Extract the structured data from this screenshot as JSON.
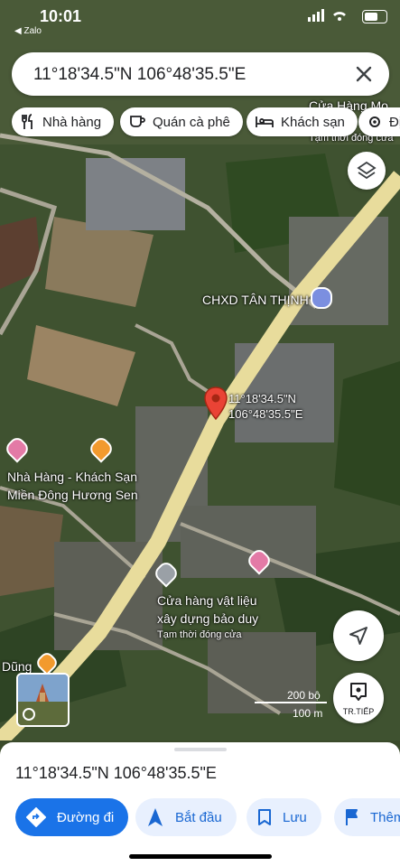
{
  "status_bar": {
    "time": "10:01",
    "back_label": "◀ Zalo"
  },
  "search": {
    "query": "11°18'34.5\"N 106°48'35.5\"E"
  },
  "chips": [
    {
      "label": "Nhà hàng",
      "icon": "fork-knife-icon"
    },
    {
      "label": "Quán cà phê",
      "icon": "coffee-cup-icon"
    },
    {
      "label": "Khách sạn",
      "icon": "bed-icon"
    },
    {
      "label": "Đị",
      "icon": "settings-icon"
    }
  ],
  "map": {
    "poi_labels": {
      "top_right": "Cửa Hàng Mo",
      "top_right_status": "Tạm thời đóng cửa",
      "gas_station": "CHXD TÂN THỊNH",
      "hotel_line1": "Nhà Hàng - Khách Sạn",
      "hotel_line2": "Miền Đông Hương Sen",
      "store_line1": "Cửa hàng vật liệu",
      "store_line2": "xây dựng bảo duy",
      "store_status": "Tạm thời đóng cửa",
      "left_bottom": "Dũng"
    },
    "pin_label_line1": "11°18'34.5\"N",
    "pin_label_line2": "106°48'35.5\"E",
    "scale_feet": "200 bộ",
    "scale_meters": "100 m",
    "next_label": "TR.TIẾP"
  },
  "sheet": {
    "title": "11°18'34.5\"N 106°48'35.5\"E",
    "actions": [
      {
        "label": "Đường đi",
        "icon": "directions-icon"
      },
      {
        "label": "Bắt đầu",
        "icon": "navigation-arrow-icon"
      },
      {
        "label": "Lưu",
        "icon": "bookmark-icon"
      },
      {
        "label": "Thêm",
        "icon": "flag-icon"
      }
    ]
  },
  "colors": {
    "primary": "#1a73e8",
    "secondary_bg": "#e8f0fe",
    "pin": "#ea4335",
    "road": "#e8dc9c"
  }
}
